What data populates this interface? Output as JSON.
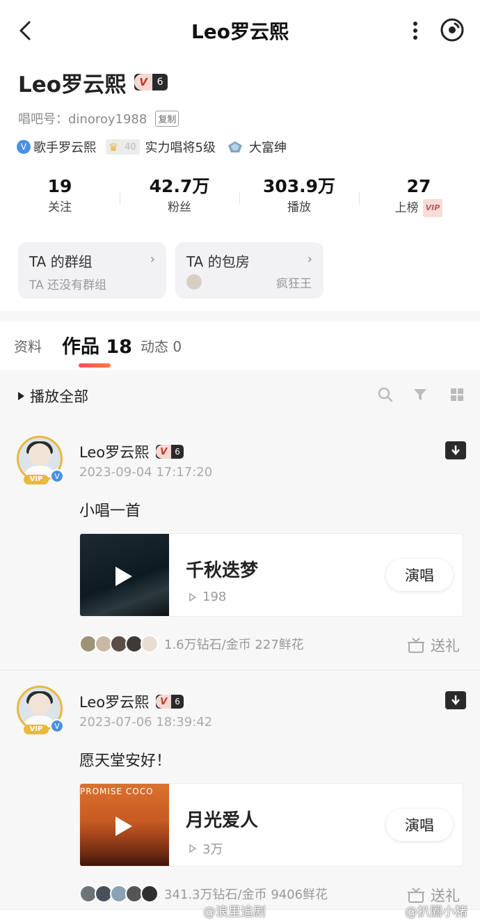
{
  "header": {
    "title": "Leo罗云熙"
  },
  "profile": {
    "name": "Leo罗云熙",
    "level": "6",
    "id_label": "唱吧号：",
    "id_value": "dinoroy1988",
    "copy_label": "复制",
    "cert_label": "歌手罗云熙",
    "singer_level_num": "40",
    "singer_level_label": "实力唱将5级",
    "wealth_label": "大富绅"
  },
  "stats": [
    {
      "value": "19",
      "label": "关注"
    },
    {
      "value": "42.7万",
      "label": "粉丝"
    },
    {
      "value": "303.9万",
      "label": "播放"
    },
    {
      "value": "27",
      "label": "上榜",
      "badge": "VIP"
    }
  ],
  "cards": [
    {
      "title": "TA 的群组",
      "subtitle": "TA 还没有群组"
    },
    {
      "title": "TA 的包房",
      "preview": "疯狂王"
    }
  ],
  "tabs": [
    {
      "label": "资料"
    },
    {
      "label": "作品 18"
    },
    {
      "label": "动态 0"
    }
  ],
  "toolbar": {
    "play_all": "播放全部"
  },
  "posts": [
    {
      "author": "Leo罗云熙",
      "level": "6",
      "vip": "VIP",
      "time": "2023-09-04 17:17:20",
      "text": "小唱一首",
      "song": {
        "title": "千秋迭梦",
        "plays": "198",
        "cover_text": ""
      },
      "sing_label": "演唱",
      "fan_stats": "1.6万钻石/金币  227鲜花",
      "gift_label": "送礼"
    },
    {
      "author": "Leo罗云熙",
      "level": "6",
      "vip": "VIP",
      "time": "2023-07-06 18:39:42",
      "text": "愿天堂安好！",
      "song": {
        "title": "月光爱人",
        "plays": "3万",
        "cover_text": "PROMISE COCO"
      },
      "sing_label": "演唱",
      "fan_stats": "341.3万钻石/金币  9406鲜花",
      "gift_label": "送礼"
    }
  ],
  "watermarks": [
    "@浪里追剧",
    "@扒圈小猪"
  ],
  "colors": {
    "accent_underline": "#ff4b5c",
    "vip_gold": "#e8b93c",
    "verified_blue": "#4a90e2"
  }
}
